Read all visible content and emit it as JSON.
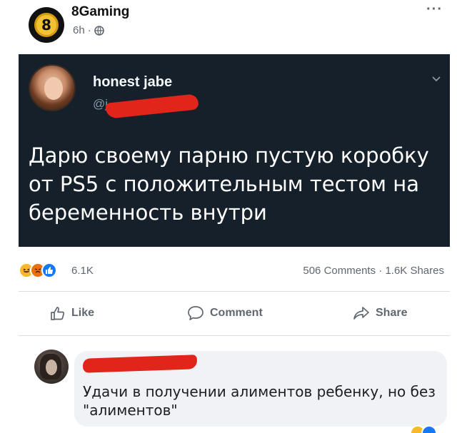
{
  "post": {
    "page_name": "8Gaming",
    "time": "6h",
    "time_sep": "·",
    "avatar_glyph": "8",
    "privacy_icon": "globe-icon",
    "more_icon": "···"
  },
  "tweet": {
    "author": "honest jabe",
    "handle": "@j",
    "text": "Дарю своему парню пустую коробку от PS5  с положительным тестом на беременность внутри",
    "chevron_icon": "chevron-down-icon",
    "background": "#15202b"
  },
  "reactions": {
    "icons": [
      "haha",
      "angry",
      "like"
    ],
    "count": "6.1K",
    "comments": "506 Comments",
    "dot": "·",
    "shares": "1.6K Shares"
  },
  "actions": {
    "like_label": "Like",
    "comment_label": "Comment",
    "share_label": "Share"
  },
  "comment": {
    "author": "",
    "text": "Удачи в получении алиментов ребенку, но без \"алиментов\""
  },
  "colors": {
    "redaction": "#e1251b",
    "meta_text": "#606770",
    "bubble": "#f0f2f5"
  }
}
